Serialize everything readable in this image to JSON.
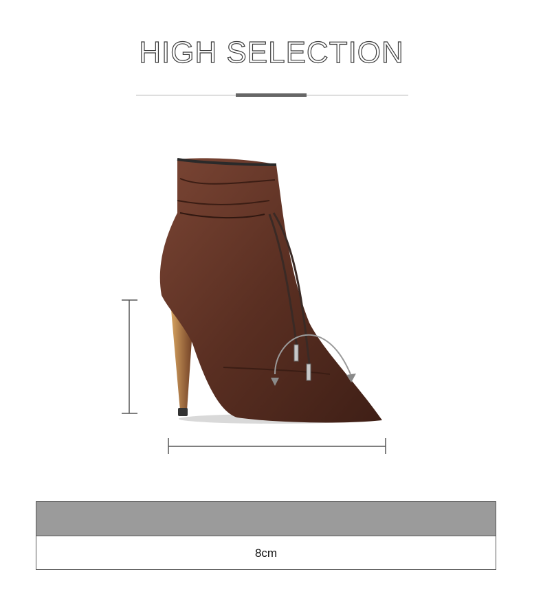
{
  "header": {
    "title": "HIGH SELECTION"
  },
  "product": {
    "image": "brown-leather-drawstring-stiletto-ankle-boot",
    "colors": {
      "leather": "#5a2f22",
      "accent_line": "#666666",
      "table_header": "#9b9b9b"
    }
  },
  "spec_table": {
    "header": "",
    "value": "8cm"
  }
}
